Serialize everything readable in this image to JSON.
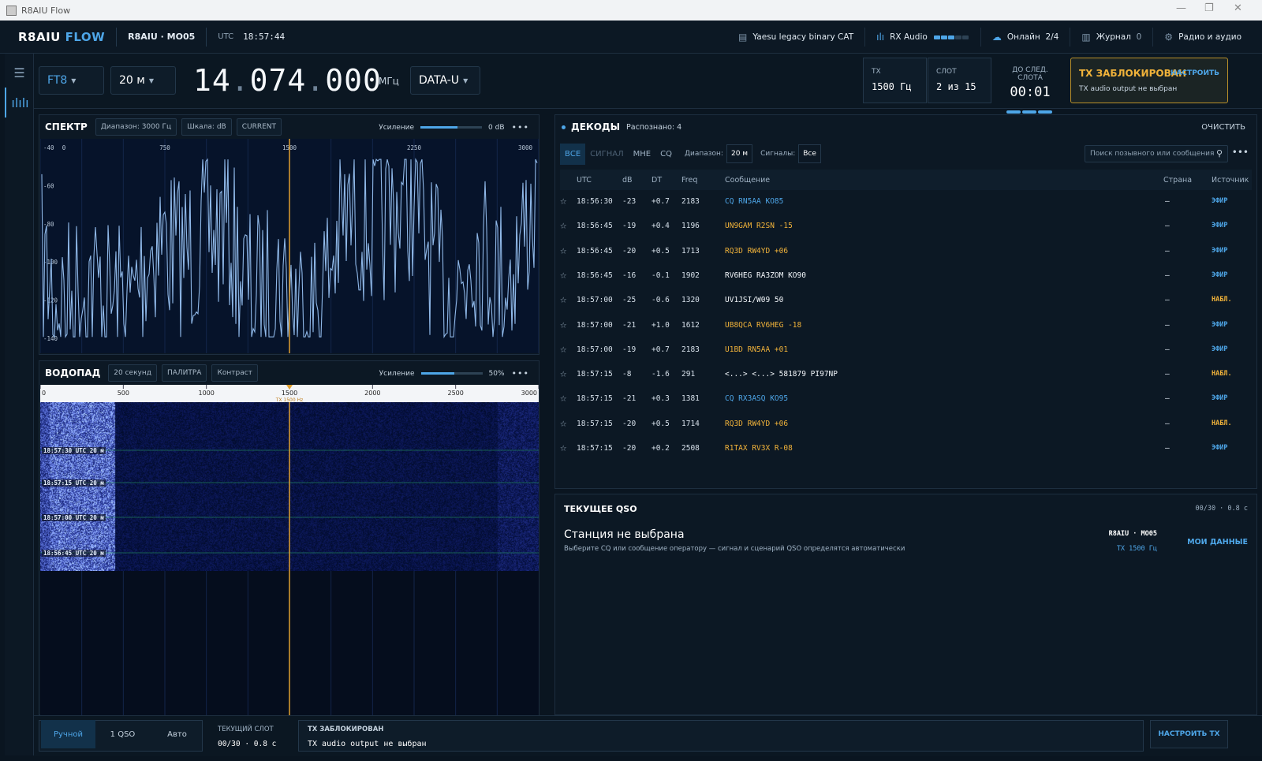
{
  "window": {
    "title": "R8AIU Flow"
  },
  "header": {
    "brand_main": "R8AIU",
    "brand_accent": "FLOW",
    "station": "R8AIU · MO05",
    "utc_label": "UTC",
    "utc_time": "18:57:44",
    "cat": "Yaesu legacy binary CAT",
    "rx_audio": "RX Audio",
    "online_label": "Онлайн",
    "online_count": "2/4",
    "log_label": "Журнал",
    "log_count": "0",
    "settings_label": "Радио и аудио"
  },
  "freqbar": {
    "mode": "FT8",
    "band": "20 м",
    "freq_a": "14",
    "freq_b": "074",
    "freq_c": "000",
    "unit": "МГц",
    "sideband": "DATA-U",
    "tx_label": "TX",
    "tx_value": "1500 Гц",
    "slot_label": "СЛОТ",
    "slot_value": "2 из 15",
    "next_label": "ДО СЛЕД. СЛОТА",
    "next_value": "00:01",
    "next_progress": 0.9,
    "lock_title": "TX ЗАБЛОКИРОВАН",
    "lock_sub": "TX audio output не выбран",
    "lock_action": "НАСТРОИТЬ"
  },
  "spectrum": {
    "title": "СПЕКТР",
    "chip_range": "Диапазон: 3000 Гц",
    "chip_scale": "Шкала: dB",
    "chip_mode": "CURRENT",
    "gain_label": "Усиление",
    "gain_value": "0 dB",
    "gain_level": 0.6,
    "x_ticks": [
      "0",
      "750",
      "1500",
      "2250",
      "3000"
    ],
    "y_ticks": [
      "-40",
      "-60",
      "-80",
      "-100",
      "-120",
      "-140"
    ]
  },
  "waterfall": {
    "title": "ВОДОПАД",
    "chip_time": "20 секунд",
    "chip_palette": "ПАЛИТРА",
    "chip_contrast": "Контраст",
    "gain_label": "Усиление",
    "gain_value": "50%",
    "gain_level": 0.55,
    "x_ticks": [
      "0",
      "500",
      "1000",
      "1500",
      "2000",
      "2500",
      "3000"
    ],
    "tx_marker": "TX 1500 Hz",
    "markers": [
      "18:57:30 UTC  20 м",
      "18:57:15 UTC  20 м",
      "18:57:00 UTC  20 м",
      "18:56:45 UTC  20 м"
    ]
  },
  "decodes": {
    "title": "ДЕКОДЫ",
    "count": "Распознано: 4",
    "clear": "ОЧИСТИТЬ",
    "tabs": [
      "ВСЕ",
      "СИГНАЛ",
      "МНЕ",
      "CQ"
    ],
    "range_label": "Диапазон:",
    "range_value": "20 м",
    "signals_label": "Сигналы:",
    "signals_value": "Все",
    "search_placeholder": "Поиск позывного или сообщения",
    "columns": [
      "UTC",
      "dB",
      "DT",
      "Freq",
      "Сообщение",
      "Страна",
      "Источник"
    ],
    "rows": [
      {
        "utc": "18:56:30",
        "db": "-23",
        "dt": "+0.7",
        "freq": "2183",
        "msg": "CQ RN5AA KO85",
        "cls": "cq",
        "country": "—",
        "src": "ЭФИР",
        "st": "air"
      },
      {
        "utc": "18:56:45",
        "db": "-19",
        "dt": "+0.4",
        "freq": "1196",
        "msg": "UN9GAM R2SN -15",
        "cls": "me",
        "country": "—",
        "src": "ЭФИР",
        "st": "air"
      },
      {
        "utc": "18:56:45",
        "db": "-20",
        "dt": "+0.5",
        "freq": "1713",
        "msg": "RQ3D RW4YD +06",
        "cls": "me",
        "country": "—",
        "src": "ЭФИР",
        "st": "air"
      },
      {
        "utc": "18:56:45",
        "db": "-16",
        "dt": "-0.1",
        "freq": "1902",
        "msg": "RV6HEG RA3ZOM KO90",
        "cls": "pl",
        "country": "—",
        "src": "ЭФИР",
        "st": "air"
      },
      {
        "utc": "18:57:00",
        "db": "-25",
        "dt": "-0.6",
        "freq": "1320",
        "msg": "UV1JSI/W09 50",
        "cls": "pl",
        "country": "—",
        "src": "НАБЛ.",
        "st": "obs"
      },
      {
        "utc": "18:57:00",
        "db": "-21",
        "dt": "+1.0",
        "freq": "1612",
        "msg": "UB8QCA RV6HEG -18",
        "cls": "me",
        "country": "—",
        "src": "ЭФИР",
        "st": "air"
      },
      {
        "utc": "18:57:00",
        "db": "-19",
        "dt": "+0.7",
        "freq": "2183",
        "msg": "U1BD RN5AA +01",
        "cls": "me",
        "country": "—",
        "src": "ЭФИР",
        "st": "air"
      },
      {
        "utc": "18:57:15",
        "db": "-8",
        "dt": "-1.6",
        "freq": "291",
        "msg": "<...> <...> 581879 PI97NP",
        "cls": "pl",
        "country": "—",
        "src": "НАБЛ.",
        "st": "obs"
      },
      {
        "utc": "18:57:15",
        "db": "-21",
        "dt": "+0.3",
        "freq": "1381",
        "msg": "CQ RX3ASQ KO95",
        "cls": "cq",
        "country": "—",
        "src": "ЭФИР",
        "st": "air"
      },
      {
        "utc": "18:57:15",
        "db": "-20",
        "dt": "+0.5",
        "freq": "1714",
        "msg": "RQ3D RW4YD +06",
        "cls": "me",
        "country": "—",
        "src": "НАБЛ.",
        "st": "obs"
      },
      {
        "utc": "18:57:15",
        "db": "-20",
        "dt": "+0.2",
        "freq": "2508",
        "msg": "R1TAX RV3X R-08",
        "cls": "me",
        "country": "—",
        "src": "ЭФИР",
        "st": "air"
      }
    ]
  },
  "qso": {
    "title": "ТЕКУЩЕЕ QSO",
    "timer": "00/30 · 0.8 с",
    "headline": "Станция не выбрана",
    "hint": "Выберите CQ или сообщение оператору — сигнал и сценарий QSO определятся автоматически",
    "station": "R8AIU · MO05",
    "tx": "TX 1500 Гц",
    "mydata": "МОИ ДАННЫЕ"
  },
  "bottom": {
    "modes": [
      "Ручной",
      "1 QSO",
      "Авто"
    ],
    "slot_label": "ТЕКУЩИЙ СЛОТ",
    "slot_value": "00/30 · 0.8 с",
    "lock_label": "TX ЗАБЛОКИРОВАН",
    "lock_value": "TX audio output не выбран",
    "configure": "НАСТРОИТЬ TX"
  },
  "colors": {
    "accent": "#4ea6e8",
    "warn": "#f0b23a",
    "bg": "#0a1520"
  }
}
